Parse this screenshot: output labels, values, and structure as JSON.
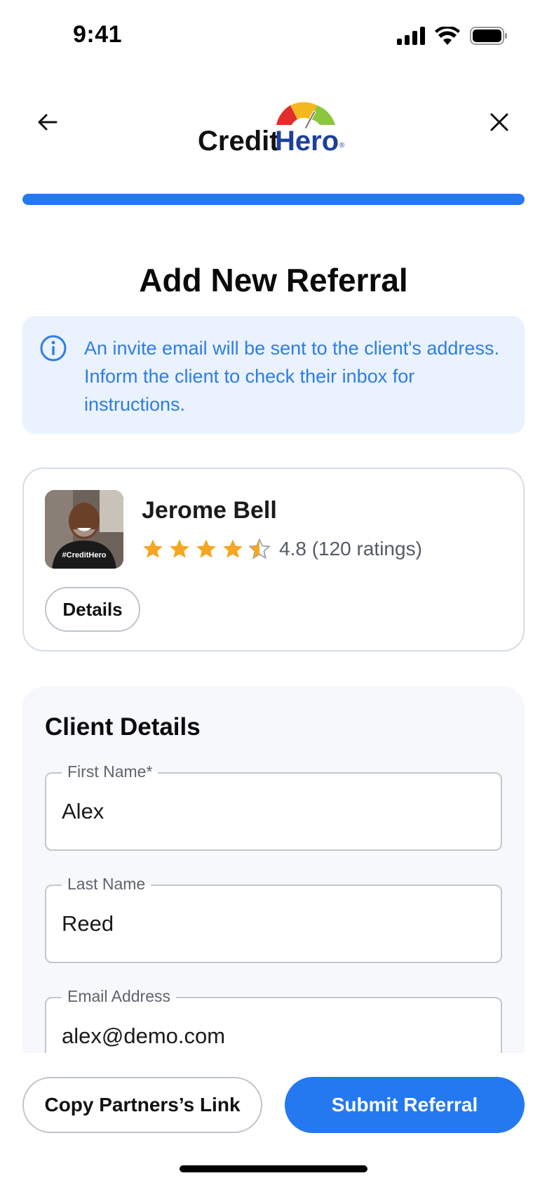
{
  "status_bar": {
    "time": "9:41",
    "icons": [
      "signal-icon",
      "wifi-icon",
      "battery-icon"
    ]
  },
  "nav": {
    "back_icon": "arrow-left-icon",
    "close_icon": "close-icon",
    "logo": {
      "part1": "Credit",
      "part2": "Hero",
      "registered": "®"
    }
  },
  "progress": {
    "value": 1.0
  },
  "page": {
    "title": "Add New Referral"
  },
  "info": {
    "icon": "info-icon",
    "text": "An invite email will be sent to the client's address. Inform the client to check their inbox for instructions."
  },
  "partner": {
    "name": "Jerome Bell",
    "rating": 4.8,
    "rating_text": "4.8 (120 ratings)",
    "stars": {
      "full": 4,
      "half": 1,
      "max": 5
    },
    "avatar_shirt_text": "#CreditHero",
    "details_label": "Details"
  },
  "client": {
    "section_title": "Client Details",
    "fields": [
      {
        "label": "First Name*",
        "value": "Alex"
      },
      {
        "label": "Last Name",
        "value": "Reed"
      },
      {
        "label": "Email Address",
        "value": "alex@demo.com"
      }
    ]
  },
  "actions": {
    "copy_label": "Copy Partners’s Link",
    "submit_label": "Submit Referral"
  },
  "colors": {
    "accent": "#2478f0",
    "info_bg": "#eaf2fd",
    "info_text": "#2f7ce6",
    "star": "#f5a623",
    "logo_dark": "#111111",
    "logo_blue": "#1d3f9e"
  }
}
